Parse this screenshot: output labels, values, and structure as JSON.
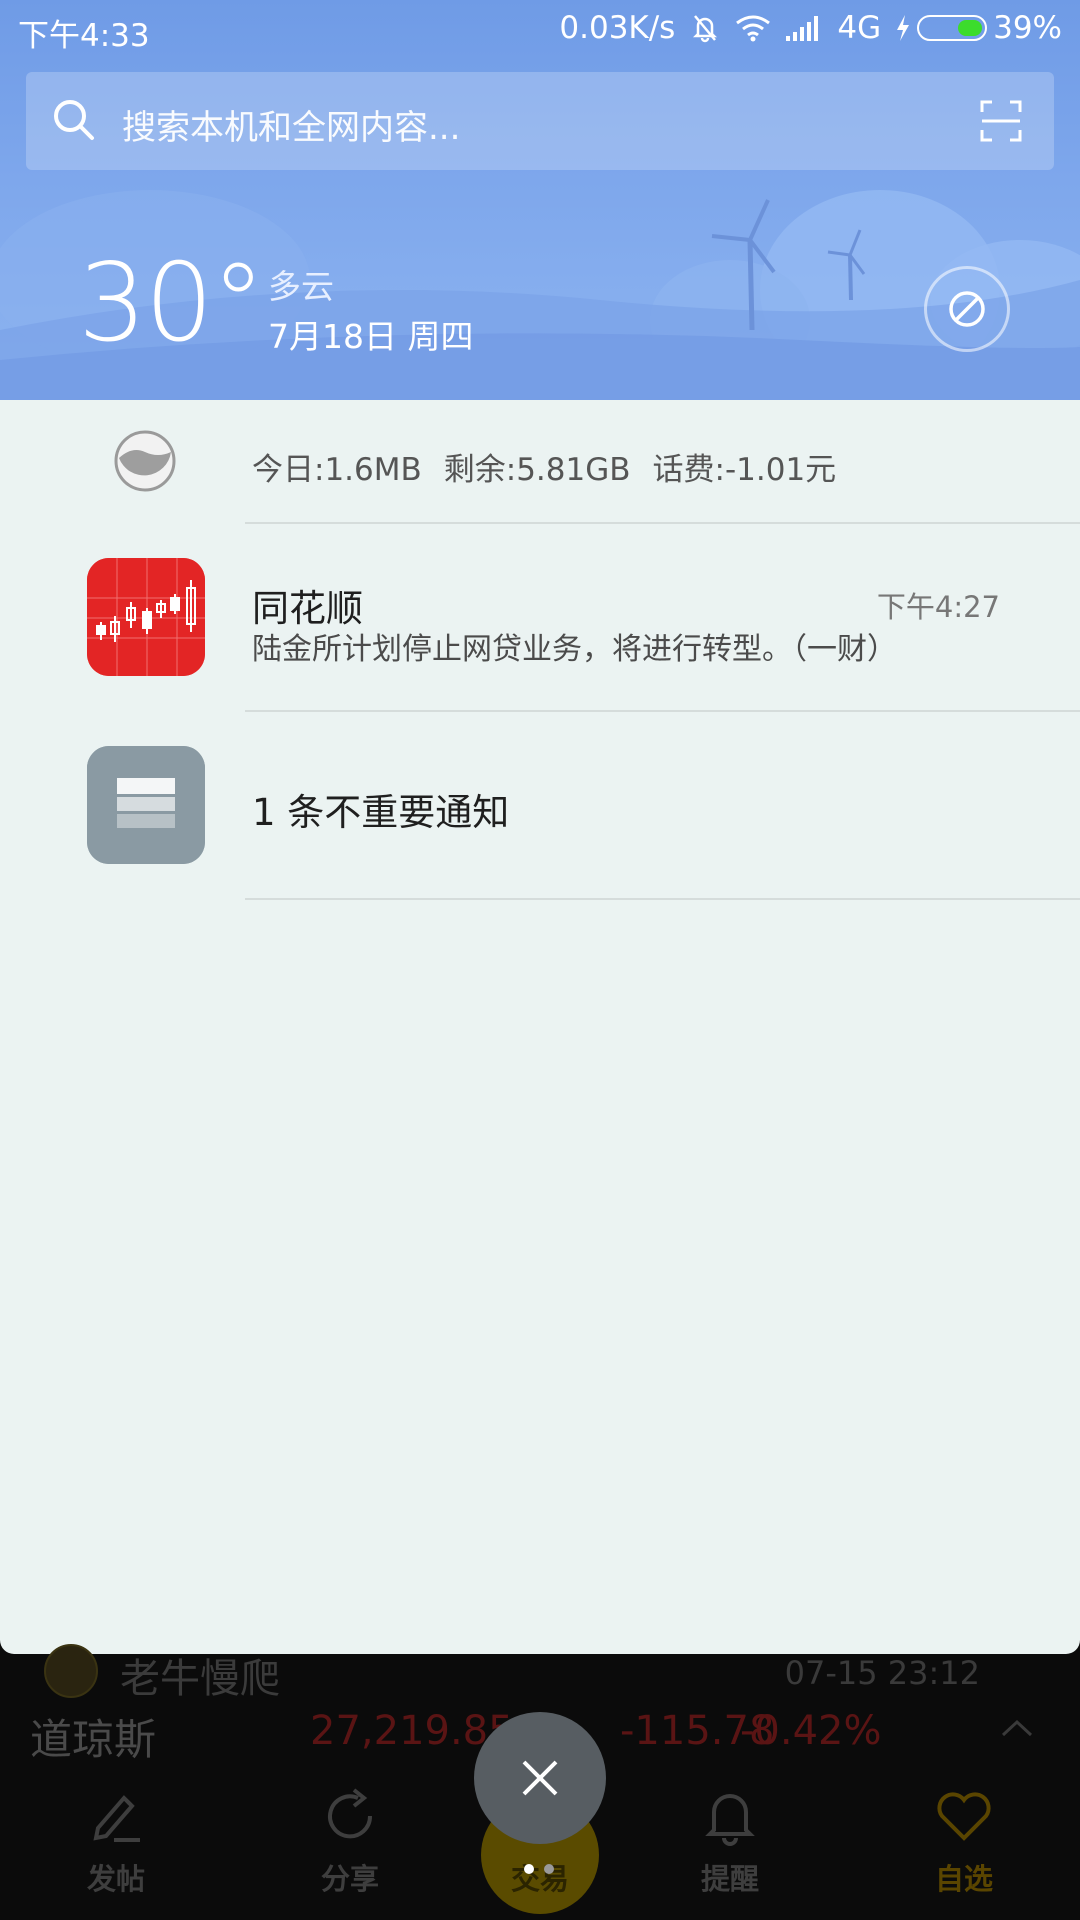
{
  "status_bar": {
    "time": "下午4:33",
    "network_speed": "0.03K/s",
    "network_type": "4G",
    "battery": "39%",
    "icons": [
      "mute-bell-icon",
      "wifi-icon",
      "signal-icon",
      "charging-icon",
      "battery-icon"
    ]
  },
  "search": {
    "placeholder": "搜索本机和全网内容...",
    "left_icon": "search-icon",
    "right_icon": "scan-icon"
  },
  "weather": {
    "temperature": "30°",
    "condition": "多云",
    "date": "7月18日 周四",
    "action_icon": "block-icon"
  },
  "data_usage": {
    "today": "今日:1.6MB",
    "remaining": "剩余:5.81GB",
    "balance": "话费:-1.01元"
  },
  "notifications": [
    {
      "app": "同花顺",
      "time": "下午4:27",
      "message": "陆金所计划停止网贷业务，将进行转型。（一财）",
      "icon": "candlestick-chart-icon",
      "icon_color": "#e32525"
    },
    {
      "label": "1 条不重要通知",
      "icon": "stack-icon",
      "icon_color": "#8a9aa3"
    }
  ],
  "background_app": {
    "author": "老牛慢爬",
    "post_time": "07-15 23:12",
    "index": {
      "name": "道琼斯",
      "value": "27,219.85",
      "change": "-115.78",
      "percent": "-0.42%"
    },
    "tabs": [
      {
        "label": "发帖",
        "icon": "edit-icon"
      },
      {
        "label": "分享",
        "icon": "share-icon"
      },
      {
        "label": "交易",
        "icon": "trade-icon"
      },
      {
        "label": "提醒",
        "icon": "bell-icon"
      },
      {
        "label": "自选",
        "icon": "heart-icon"
      }
    ]
  },
  "close_button": {
    "icon": "close-icon"
  },
  "colors": {
    "header_blue": "#7ea7ec",
    "panel_bg": "#ebf3f2",
    "battery_green": "#3cdc2c",
    "app_red": "#e32525",
    "fab_gray": "#575d62"
  }
}
